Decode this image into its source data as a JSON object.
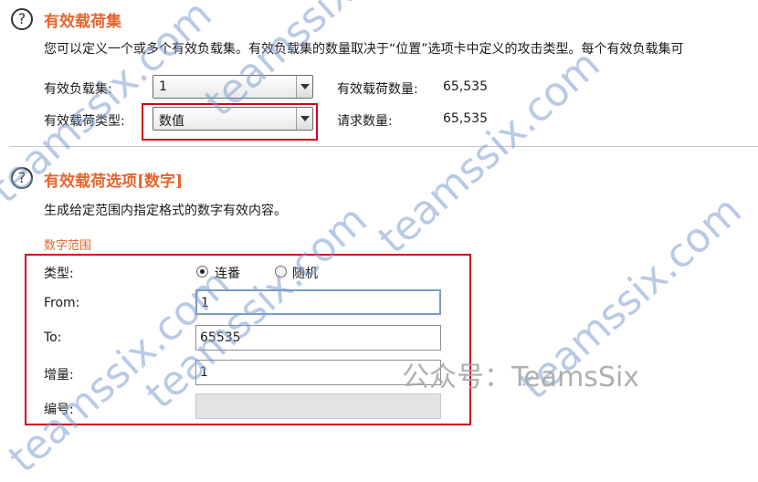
{
  "payload_sets": {
    "title": "有效载荷集",
    "description": "您可以定义一个或多个有效负载集。有效负载集的数量取决于“位置”选项卡中定义的攻击类型。每个有效负载集可",
    "set_label": "有效负载集:",
    "set_value": "1",
    "type_label": "有效载荷类型:",
    "type_value": "数值",
    "count_label": "有效载荷数量:",
    "count_value": "65,535",
    "requests_label": "请求数量:",
    "requests_value": "65,535"
  },
  "payload_options": {
    "title": "有效载荷选项[数字]",
    "description": "生成给定范围内指定格式的数字有效内容。",
    "range_heading": "数字范围",
    "type_label": "类型:",
    "type_options": [
      "连番",
      "随机"
    ],
    "type_selected": "连番",
    "from_label": "From:",
    "from_value": "1",
    "to_label": "To:",
    "to_value": "65535",
    "step_label": "增量:",
    "step_value": "1",
    "number_label": "编号:",
    "number_value": ""
  },
  "watermark": {
    "text": "teamssix.com",
    "wechat": "公众号：TeamsSix"
  },
  "colors": {
    "accent": "#e8642c",
    "highlight_box": "#d0021b",
    "watermark": "#7f9fd0"
  }
}
